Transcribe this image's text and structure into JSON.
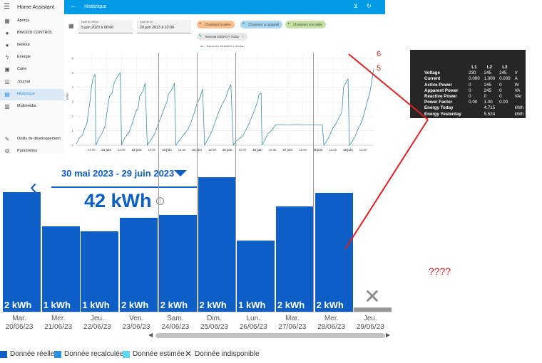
{
  "app_title": "Home Assistant",
  "sidebar": {
    "items": [
      {
        "label": "Aperçu",
        "icon": "dashboard-icon",
        "glyph": "▦"
      },
      {
        "label": "BWOOD CONTROL",
        "icon": "person-icon",
        "glyph": "●"
      },
      {
        "label": "lookout",
        "icon": "person-icon",
        "glyph": "●"
      },
      {
        "label": "Énergie",
        "icon": "lightning-icon",
        "glyph": "ϟ"
      },
      {
        "label": "Carte",
        "icon": "map-icon",
        "glyph": "▣"
      },
      {
        "label": "Journal",
        "icon": "list-icon",
        "glyph": "☰"
      },
      {
        "label": "Historique",
        "icon": "chart-icon",
        "glyph": "▤"
      },
      {
        "label": "Multimédia",
        "icon": "media-icon",
        "glyph": "▥"
      },
      {
        "label": "Outils de développement",
        "icon": "wrench-icon",
        "glyph": "✎"
      },
      {
        "label": "Paramètres",
        "icon": "gear-icon",
        "glyph": "⚙"
      }
    ]
  },
  "topbar": {
    "title": "Historique",
    "back_icon": "arrow-left-icon",
    "filter_icon": "filter-remove-icon",
    "refresh_icon": "refresh-icon"
  },
  "filters": {
    "start_label": "Date de début",
    "start_value": "5 juin 2023 à 00:00",
    "end_label": "Date de fin",
    "end_value": "29 juin 2023 à 22:00",
    "chip_room": "Choisissez la pièce",
    "chip_device": "Choisissez un appareil",
    "chip_entity": "Choisissez une entité",
    "chip_selected": "Tasmota ENERGY Today",
    "legend_label": "Tasmota ENERGY Today",
    "colors": {
      "room": "#f9c08d",
      "device": "#a8d7f2",
      "entity": "#c5e1a5",
      "series": "#3b8fa3"
    }
  },
  "ha_chart": {
    "y_unit": "kWh",
    "y_ticks": [
      "0",
      "1",
      "2",
      "3",
      "4",
      "5",
      "6"
    ],
    "x_ticks": [
      "12:00",
      "21 juin",
      "12:00",
      "22 juin",
      "12:00",
      "23 juin",
      "12:00",
      "24 juin",
      "12:00",
      "25 juin",
      "12:00",
      "26 juin",
      "12:00",
      "27 juin",
      "12:00",
      "28 juin",
      "12:00",
      "29 juin",
      "12:00"
    ],
    "x_range_days": [
      20.0,
      29.85
    ],
    "series": [
      [
        20.0,
        0.1
      ],
      [
        20.1,
        0.5
      ],
      [
        20.2,
        0.7
      ],
      [
        20.25,
        1.0
      ],
      [
        20.35,
        1.5
      ],
      [
        20.45,
        3.0
      ],
      [
        20.5,
        4.0
      ],
      [
        20.55,
        4.6
      ],
      [
        20.62,
        4.9
      ],
      [
        20.65,
        0
      ],
      [
        20.75,
        0.5
      ],
      [
        20.85,
        0.8
      ],
      [
        20.95,
        1.3
      ],
      [
        21.0,
        2.0
      ],
      [
        21.05,
        2.8
      ],
      [
        21.1,
        3.4
      ],
      [
        21.18,
        3.6
      ],
      [
        21.25,
        4.3
      ],
      [
        21.35,
        4.7
      ],
      [
        21.45,
        5.0
      ],
      [
        21.5,
        0
      ],
      [
        21.6,
        0.5
      ],
      [
        21.75,
        0.9
      ],
      [
        21.85,
        1.5
      ],
      [
        21.95,
        2.2
      ],
      [
        22.05,
        2.6
      ],
      [
        22.1,
        3.4
      ],
      [
        22.2,
        3.7
      ],
      [
        22.28,
        4.3
      ],
      [
        22.35,
        0
      ],
      [
        22.45,
        0.3
      ],
      [
        22.6,
        0.8
      ],
      [
        22.7,
        1.4
      ],
      [
        22.8,
        1.9
      ],
      [
        22.9,
        2.5
      ],
      [
        23.0,
        3.0
      ],
      [
        23.05,
        3.5
      ],
      [
        23.15,
        3.8
      ],
      [
        23.25,
        4.3
      ],
      [
        23.3,
        0
      ],
      [
        23.4,
        0.3
      ],
      [
        23.55,
        0.7
      ],
      [
        23.7,
        1.1
      ],
      [
        23.8,
        1.6
      ],
      [
        23.9,
        2.2
      ],
      [
        24.0,
        2.9
      ],
      [
        24.1,
        3.3
      ],
      [
        24.18,
        3.9
      ],
      [
        24.25,
        0
      ],
      [
        24.35,
        0.4
      ],
      [
        24.5,
        1.0
      ],
      [
        24.6,
        1.6
      ],
      [
        24.7,
        2.2
      ],
      [
        24.8,
        2.7
      ],
      [
        24.95,
        3.3
      ],
      [
        25.05,
        3.9
      ],
      [
        25.12,
        4.2
      ],
      [
        25.2,
        0
      ],
      [
        25.3,
        0.3
      ],
      [
        25.5,
        0.6
      ],
      [
        25.6,
        1.0
      ],
      [
        25.7,
        1.4
      ],
      [
        25.8,
        1.9
      ],
      [
        25.9,
        2.4
      ],
      [
        26.0,
        3.0
      ],
      [
        26.05,
        3.5
      ],
      [
        26.12,
        3.6
      ],
      [
        26.15,
        0
      ],
      [
        26.25,
        0.4
      ],
      [
        26.35,
        0.8
      ],
      [
        26.45,
        1.0
      ],
      [
        26.6,
        1.4
      ],
      [
        28.15,
        1.4
      ],
      [
        28.2,
        0
      ],
      [
        28.3,
        0.3
      ],
      [
        28.4,
        0.7
      ],
      [
        28.5,
        1.2
      ],
      [
        28.6,
        1.5
      ],
      [
        28.7,
        1.9
      ],
      [
        28.8,
        2.3
      ],
      [
        28.85,
        4.0
      ],
      [
        28.95,
        4.4
      ],
      [
        29.0,
        4.6
      ],
      [
        29.05,
        0
      ],
      [
        29.15,
        0.3
      ],
      [
        29.25,
        0.7
      ],
      [
        29.35,
        1.2
      ],
      [
        29.45,
        1.6
      ],
      [
        29.55,
        2.3
      ],
      [
        29.65,
        3.1
      ],
      [
        29.72,
        3.6
      ],
      [
        29.8,
        4.6
      ],
      [
        29.85,
        5.3
      ]
    ]
  },
  "bigchart": {
    "period": "30 mai 2023 - 29 juin 2023",
    "total": "42 kWh",
    "bars": [
      {
        "day": "Mar.",
        "date": "20/06/23",
        "value": 1.56,
        "label": "2 kWh"
      },
      {
        "day": "Mer.",
        "date": "21/06/23",
        "value": 1.11,
        "label": "1 kWh"
      },
      {
        "day": "Jeu.",
        "date": "22/06/23",
        "value": 1.05,
        "label": "1 kWh"
      },
      {
        "day": "Ven.",
        "date": "23/06/23",
        "value": 1.22,
        "label": "2 kWh"
      },
      {
        "day": "Sam.",
        "date": "24/06/23",
        "value": 1.26,
        "label": "2 kWh"
      },
      {
        "day": "Dim.",
        "date": "25/06/23",
        "value": 1.75,
        "label": "2 kWh"
      },
      {
        "day": "Lun.",
        "date": "26/06/23",
        "value": 0.93,
        "label": "1 kWh"
      },
      {
        "day": "Mar.",
        "date": "27/06/23",
        "value": 1.37,
        "label": "2 kWh"
      },
      {
        "day": "Mer.",
        "date": "28/06/23",
        "value": 1.55,
        "label": "2 kWh"
      },
      {
        "day": "Jeu.",
        "date": "29/06/23",
        "value": null,
        "label": ""
      }
    ],
    "bar_color": "#0d5ec7",
    "legend": [
      {
        "label": "Donnée réelle",
        "color": "#0d5ec7"
      },
      {
        "label": "Donnée recalculée",
        "color": "#2e8fe0"
      },
      {
        "label": "Donnée estimée",
        "color": "#5fd6f5"
      },
      {
        "label": "Donnée indisponible",
        "color": "#333333"
      }
    ]
  },
  "tasmota": {
    "columns": [
      "L1",
      "L2",
      "L3"
    ],
    "rows": [
      {
        "k": "Voltage",
        "v": [
          "230",
          "245",
          "245"
        ],
        "u": "V"
      },
      {
        "k": "Current",
        "v": [
          "0.000",
          "1.000",
          "0.000"
        ],
        "u": "A"
      },
      {
        "k": "Active Power",
        "v": [
          "0",
          "245",
          "0"
        ],
        "u": "W"
      },
      {
        "k": "Apparent Power",
        "v": [
          "0",
          "245",
          "0"
        ],
        "u": "VA"
      },
      {
        "k": "Reactive Power",
        "v": [
          "0",
          "0",
          "0"
        ],
        "u": "VAr"
      },
      {
        "k": "Power Factor",
        "v": [
          "0.00",
          "1.00",
          "0.00"
        ],
        "u": ""
      },
      {
        "k": "Energy Today",
        "v": [
          "",
          "4.715",
          ""
        ],
        "u": "kWh"
      },
      {
        "k": "Energy Yesterday",
        "v": [
          "",
          "5.524",
          ""
        ],
        "u": "kWh"
      }
    ]
  },
  "annotations": {
    "marker_6": "6",
    "marker_5": "5",
    "question": "????",
    "line_color": "#e02020"
  }
}
